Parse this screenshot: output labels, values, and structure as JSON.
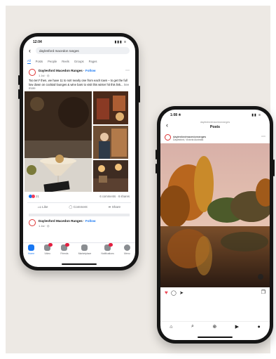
{
  "facebook": {
    "status": {
      "time": "12:04",
      "signal": "▮▮▮ ≡"
    },
    "search": {
      "query": "daylesford macedon ranges",
      "back": "‹"
    },
    "tabs": [
      {
        "label": "All",
        "active": true
      },
      {
        "label": "Posts"
      },
      {
        "label": "People"
      },
      {
        "label": "Reels"
      },
      {
        "label": "Groups"
      },
      {
        "label": "Pages"
      }
    ],
    "post": {
      "author": "Daylesford Macedon Ranges",
      "follow": "Follow",
      "meta": "1 Jul · ◎",
      "menu": "⋯",
      "caption": "Too ten? then, we have 11 to not! nearly one from each town – to get the full low down on cocktail lounges & wine bars to visit this winter hit this link...",
      "see_more": "See more",
      "reactions": "21",
      "comments": "6 comments",
      "shares": "6 shares",
      "actions": [
        {
          "icon": "like-icon",
          "label": "Like"
        },
        {
          "icon": "comment-icon",
          "label": "Comment"
        },
        {
          "icon": "share-icon",
          "label": "Share"
        }
      ]
    },
    "post2": {
      "author": "Daylesford Macedon Ranges",
      "follow": "Follow",
      "meta": "1 Jul · ◎"
    },
    "nav": [
      {
        "icon": "home-icon",
        "label": "Home",
        "active": true
      },
      {
        "icon": "video-icon",
        "label": "Video",
        "badge": true
      },
      {
        "icon": "friends-icon",
        "label": "Friends",
        "badge": true
      },
      {
        "icon": "marketplace-icon",
        "label": "Marketplace"
      },
      {
        "icon": "notifications-icon",
        "label": "Notifications",
        "badge": true
      },
      {
        "icon": "menu-icon",
        "label": "Menu"
      }
    ]
  },
  "instagram": {
    "status": {
      "time": "1:08 ✳",
      "signal": "▮▮ ≡"
    },
    "header": {
      "back": "‹",
      "username_small": "daylesfordmacedonranges",
      "title": "Posts"
    },
    "post": {
      "username": "daylesfordmacedonranges",
      "location": "Daylesford, Victoria Australia",
      "menu": "⋯"
    },
    "actions": {
      "like": "♥",
      "comment": "◯",
      "share": "➤",
      "save": "❐"
    },
    "nav_icons": [
      "home-icon",
      "search-icon",
      "add-post-icon",
      "reels-icon",
      "profile-icon"
    ],
    "nav_glyphs": [
      "⌂",
      "⌕",
      "⊕",
      "▶",
      "●"
    ]
  },
  "colors": {
    "background": "#ede9e4",
    "facebook_blue": "#1877f2",
    "instagram_like": "#ed4956",
    "phone_frame": "#151515"
  }
}
